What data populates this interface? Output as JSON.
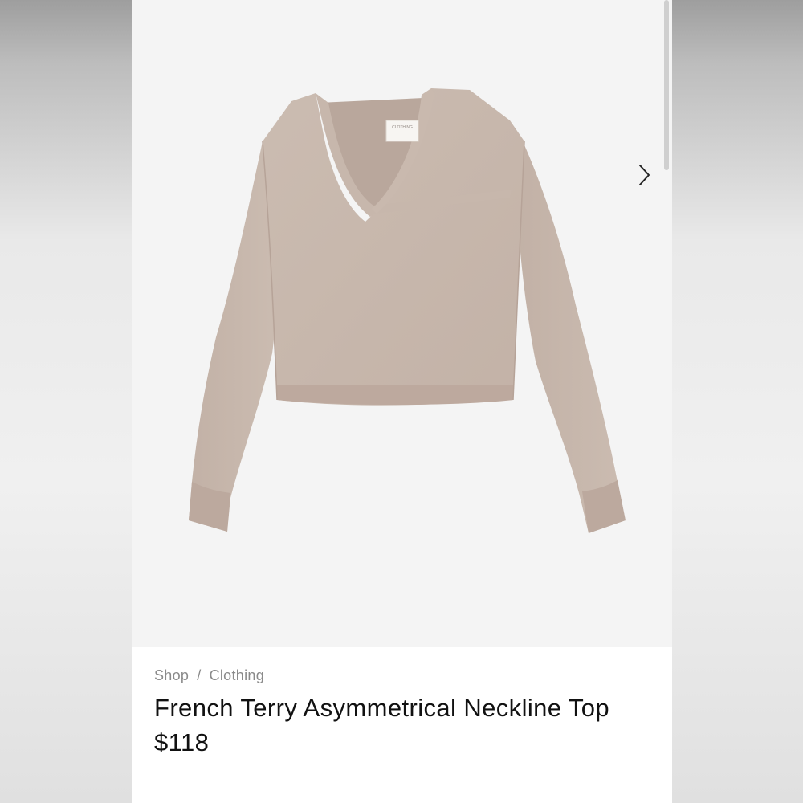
{
  "breadcrumb": {
    "items": [
      {
        "label": "Shop"
      },
      {
        "label": "Clothing"
      }
    ],
    "separator": "/"
  },
  "product": {
    "title": "French Terry Asymmetrical Neckline Top",
    "price": "$118",
    "image_label": "CLOTHING",
    "garment_color": "#c8b8ad"
  },
  "gallery": {
    "next_icon": "chevron-right-icon"
  }
}
